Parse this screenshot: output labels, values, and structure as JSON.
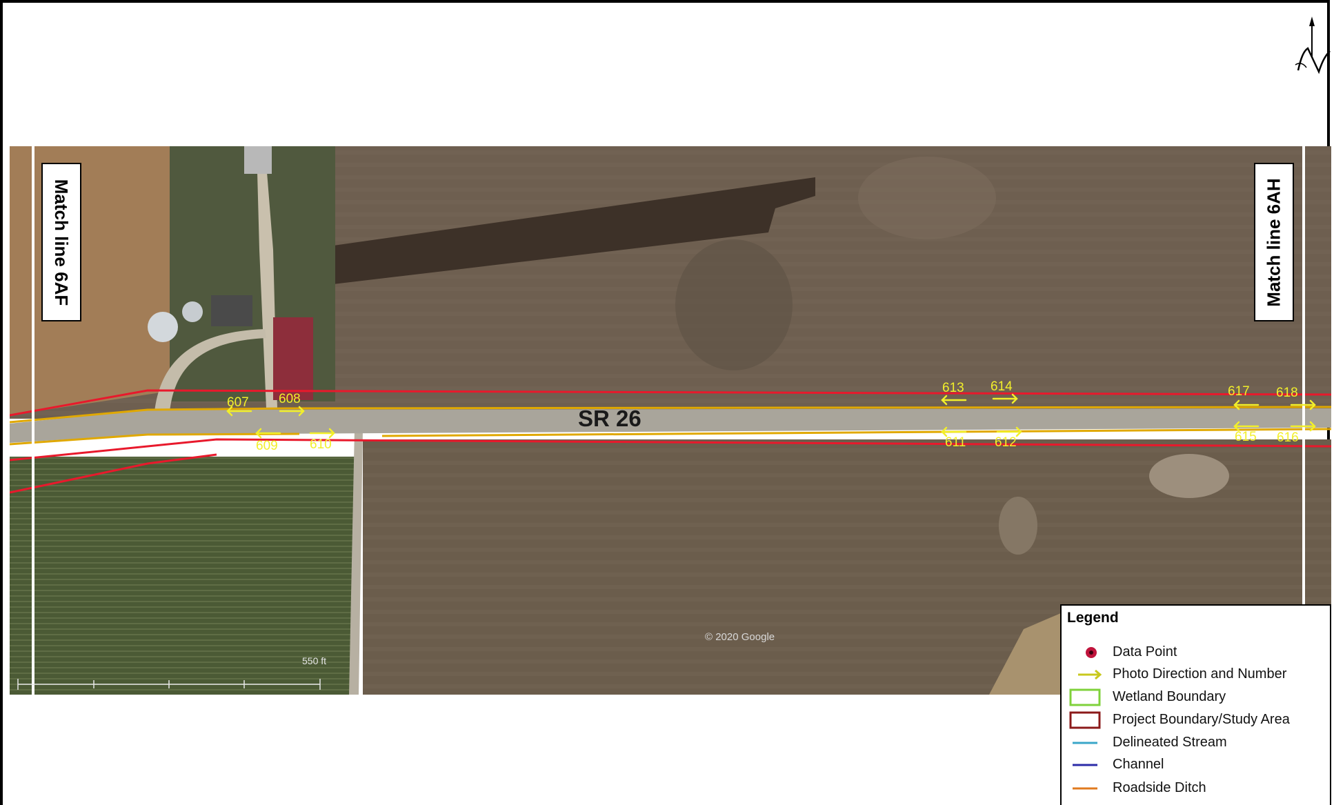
{
  "match_lines": {
    "left": "Match line 6AF",
    "right": "Match line 6AH"
  },
  "road_label": "SR 26",
  "copyright": "© 2020 Google",
  "scale_label": "550 ft",
  "photo_points": [
    {
      "number": "607",
      "direction": "W"
    },
    {
      "number": "608",
      "direction": "E"
    },
    {
      "number": "609",
      "direction": "W"
    },
    {
      "number": "610",
      "direction": "E"
    },
    {
      "number": "611",
      "direction": "W"
    },
    {
      "number": "612",
      "direction": "E"
    },
    {
      "number": "613",
      "direction": "W"
    },
    {
      "number": "614",
      "direction": "E"
    },
    {
      "number": "615",
      "direction": "W"
    },
    {
      "number": "616",
      "direction": "E"
    },
    {
      "number": "617",
      "direction": "W"
    },
    {
      "number": "618",
      "direction": "E"
    }
  ],
  "legend": {
    "title": "Legend",
    "items": [
      {
        "label": "Data Point",
        "symbol": "data-point",
        "color": "#c0143c"
      },
      {
        "label": "Photo Direction and Number",
        "symbol": "arrow",
        "color": "#c8c81e"
      },
      {
        "label": "Wetland Boundary",
        "symbol": "box",
        "color": "#7fd13b"
      },
      {
        "label": "Project Boundary/Study Area",
        "symbol": "box",
        "color": "#8b1a1a"
      },
      {
        "label": "Delineated Stream",
        "symbol": "line",
        "color": "#3aa6c8"
      },
      {
        "label": "Channel",
        "symbol": "line",
        "color": "#2b2ba8"
      },
      {
        "label": "Roadside Ditch",
        "symbol": "line",
        "color": "#e07a1f"
      }
    ]
  },
  "colors": {
    "project_boundary": "#e8192c",
    "roadside_ditch": "#e0a800",
    "photo_arrow": "#f2ef2a",
    "match_line": "#ffffff"
  }
}
